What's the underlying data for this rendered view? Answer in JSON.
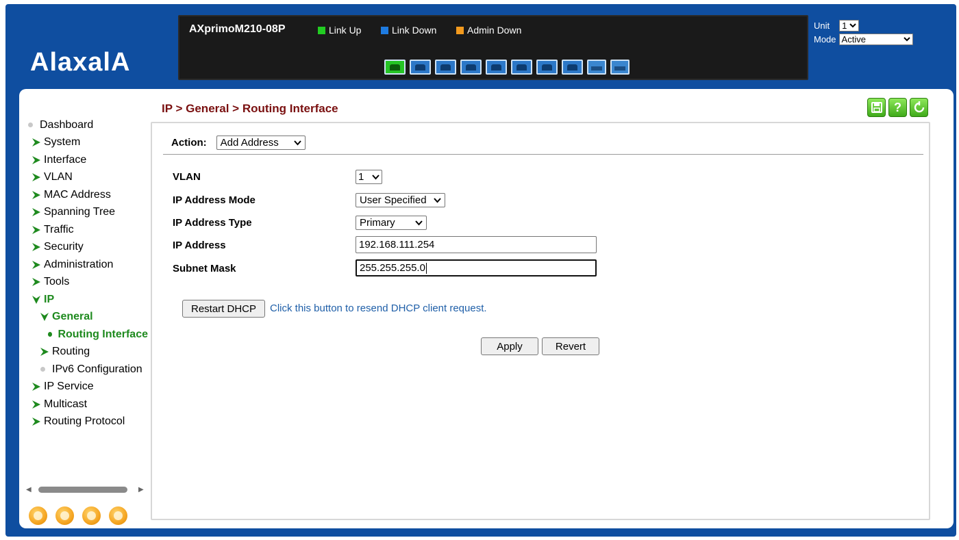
{
  "brand": {
    "logo_text": "AlaxalA"
  },
  "device": {
    "model": "AXprimoM210-08P",
    "legend": [
      {
        "label": "Link Up",
        "color": "#22cc22"
      },
      {
        "label": "Link Down",
        "color": "#1e7be0"
      },
      {
        "label": "Admin Down",
        "color": "#f39a1e"
      }
    ],
    "ports": [
      "up",
      "down",
      "down",
      "down",
      "down",
      "down",
      "down",
      "down",
      "sfp-down",
      "sfp-down"
    ]
  },
  "unit_mode": {
    "unit_label": "Unit",
    "unit_value": "1",
    "mode_label": "Mode",
    "mode_value": "Active"
  },
  "breadcrumb": "IP > General > Routing Interface",
  "toolbar": {
    "save": "save-icon",
    "help": "?",
    "refresh": "refresh-icon"
  },
  "sidebar": {
    "items": [
      {
        "label": "Dashboard",
        "icon": "dot"
      },
      {
        "label": "System",
        "icon": "arrow"
      },
      {
        "label": "Interface",
        "icon": "arrow"
      },
      {
        "label": "VLAN",
        "icon": "arrow"
      },
      {
        "label": "MAC Address",
        "icon": "arrow"
      },
      {
        "label": "Spanning Tree",
        "icon": "arrow"
      },
      {
        "label": "Traffic",
        "icon": "arrow"
      },
      {
        "label": "Security",
        "icon": "arrow"
      },
      {
        "label": "Administration",
        "icon": "arrow"
      },
      {
        "label": "Tools",
        "icon": "arrow"
      },
      {
        "label": "IP",
        "icon": "arrow-down"
      },
      {
        "label": "General",
        "icon": "arrow-down"
      },
      {
        "label": "Routing Interface",
        "icon": "dot-active"
      },
      {
        "label": "Routing",
        "icon": "arrow"
      },
      {
        "label": "IPv6 Configuration",
        "icon": "dot"
      },
      {
        "label": "IP Service",
        "icon": "arrow"
      },
      {
        "label": "Multicast",
        "icon": "arrow"
      },
      {
        "label": "Routing Protocol",
        "icon": "arrow"
      }
    ]
  },
  "form": {
    "action_label": "Action:",
    "action_value": "Add Address",
    "fields": {
      "vlan": {
        "label": "VLAN",
        "value": "1"
      },
      "ip_mode": {
        "label": "IP Address Mode",
        "value": "User Specified"
      },
      "ip_type": {
        "label": "IP Address Type",
        "value": "Primary"
      },
      "ip_address": {
        "label": "IP Address",
        "value": "192.168.111.254"
      },
      "subnet_mask": {
        "label": "Subnet Mask",
        "value": "255.255.255.0"
      }
    },
    "restart_dhcp_label": "Restart DHCP",
    "restart_dhcp_hint": "Click this button to resend DHCP client request.",
    "apply_label": "Apply",
    "revert_label": "Revert"
  },
  "colors": {
    "frame_blue": "#0f4ea0",
    "breadcrumb": "#7a1010",
    "nav_active": "#1e8a1e",
    "hint_blue": "#1f5fa8"
  },
  "footer_icons": [
    "network-icon",
    "back-icon",
    "mail-icon",
    "globe-icon"
  ]
}
